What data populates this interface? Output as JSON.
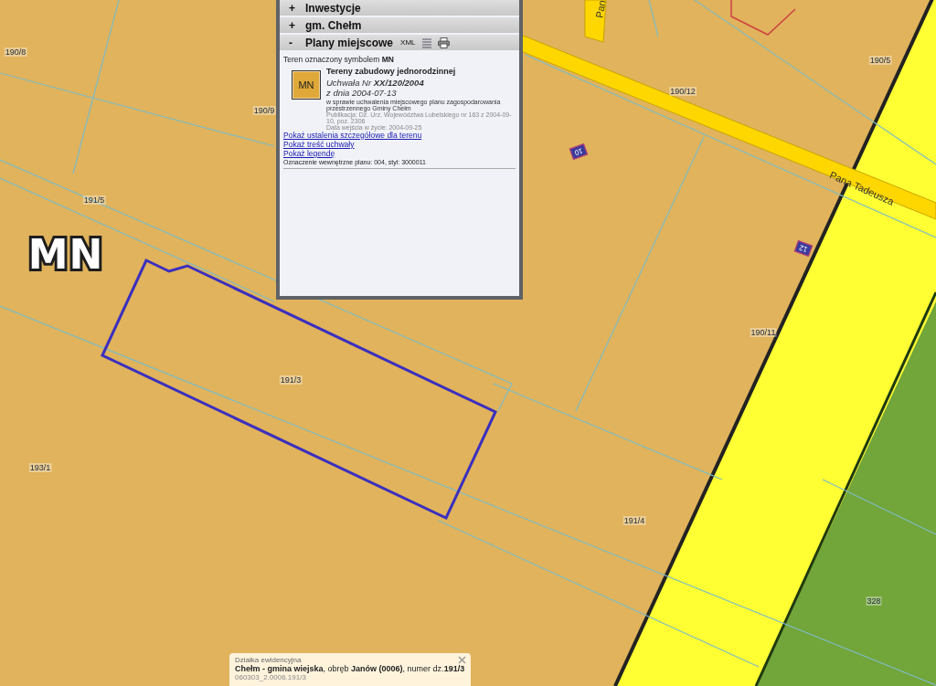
{
  "map": {
    "zone_label": "MN",
    "parcels": [
      {
        "text": "190/8"
      },
      {
        "text": "190/9"
      },
      {
        "text": "191/5"
      },
      {
        "text": "190/12"
      },
      {
        "text": "190/5"
      },
      {
        "text": "190/11"
      },
      {
        "text": "191/3"
      },
      {
        "text": "193/1"
      },
      {
        "text": "191/4"
      },
      {
        "text": "328"
      }
    ],
    "house_numbers": [
      {
        "text": "10"
      },
      {
        "text": "12"
      }
    ],
    "streets": [
      {
        "text": "Pana Tadeusza"
      },
      {
        "text": "Pan"
      }
    ]
  },
  "panel": {
    "sections": [
      {
        "toggle": "+",
        "label": "Inwestycje"
      },
      {
        "toggle": "+",
        "label": "gm. Chełm"
      },
      {
        "toggle": "-",
        "label": "Plany miejscowe",
        "format_tag": "XML"
      }
    ],
    "plan": {
      "intro": "Teren oznaczony symbolem **MN**",
      "symbol": "MN",
      "title": "Tereny zabudowy jednorodzinnej",
      "resolution": "Uchwała Nr **XX/120/2004**",
      "date": "z dnia 2004-07-13",
      "subject": "w sprawie uchwalenia miejscowego planu zagospodarowania przestrzennego Gminy Chełm",
      "publication": "Publikacja: Dz. Urz. Województwa Lubelskiego nr 163 z 2004-09-10, poz. 2306",
      "effective": "Data wejścia w życie: 2004-09-25",
      "links": [
        "Pokaż ustalenia szczegółowe dla terenu",
        "Pokaż treść uchwały",
        "Pokaż legendę"
      ],
      "designation": "Oznaczenie wewnętrzne planu: 004, styl: 3000011"
    }
  },
  "popup": {
    "title": "Działka ewidencyjna",
    "description": "**Chełm - gmina wiejska**, obręb **Janów (0006)**, numer dz.**191/3**",
    "identifier": "060303_2.0006.191/3"
  }
}
